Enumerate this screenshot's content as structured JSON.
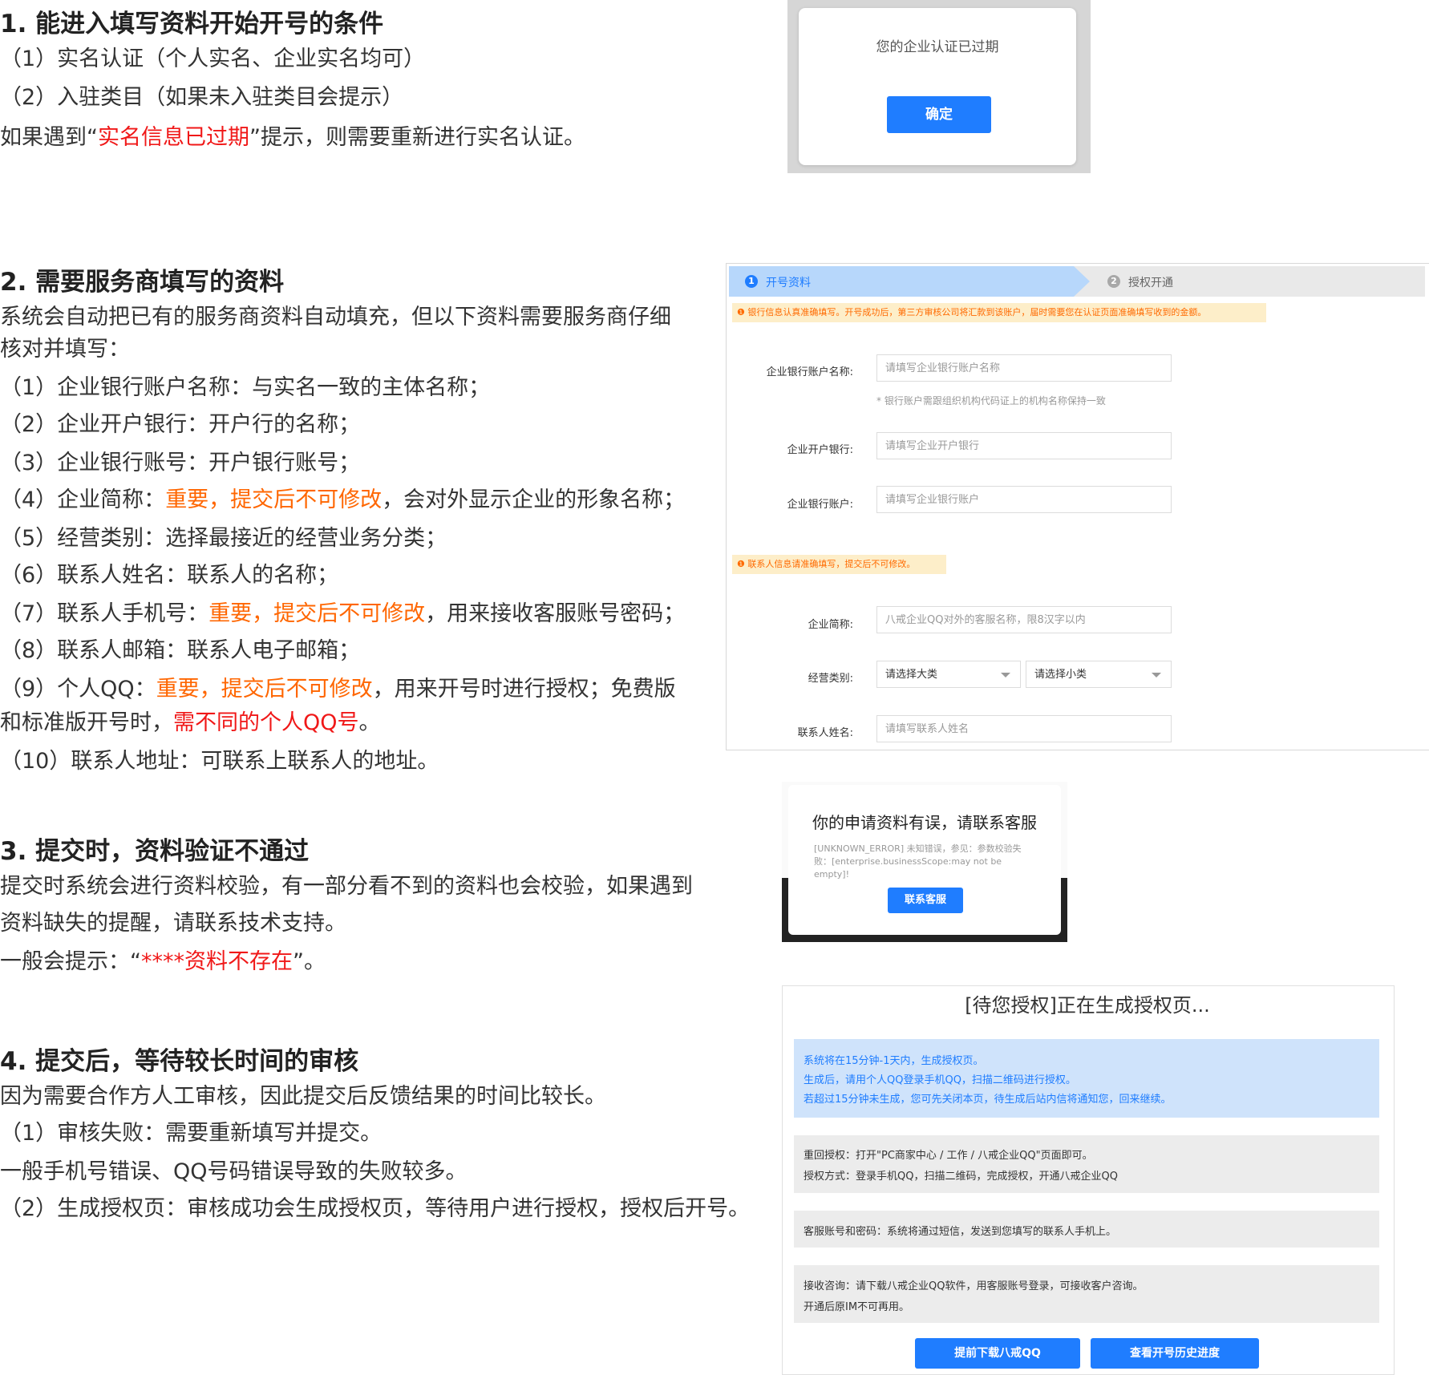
{
  "sec1": {
    "title": "1. 能进入填写资料开始开号的条件",
    "items": [
      "（1）实名认证（个人实名、企业实名均可）",
      "（2）入驻类目（如果未入驻类目会提示）"
    ],
    "note_a": "如果遇到“",
    "note_red": "实名信息已过期",
    "note_b": "”提示，则需要重新进行实名认证。"
  },
  "modal1": {
    "text": "您的企业认证已过期",
    "button": "确定"
  },
  "sec2": {
    "title": "2. 需要服务商填写的资料",
    "intro1": "系统会自动把已有的服务商资料自动填充，但以下资料需要服务商仔细",
    "intro2": "核对并填写：",
    "i1": "（1）企业银行账户名称：与实名一致的主体名称；",
    "i2": "（2）企业开户银行：开户行的名称；",
    "i3": "（3）企业银行账号：开户银行账号；",
    "i4a": "（4）企业简称：",
    "i4o": "重要，提交后不可修改",
    "i4b": "，会对外显示企业的形象名称；",
    "i5": "（5）经营类别：选择最接近的经营业务分类；",
    "i6": "（6）联系人姓名：联系人的名称；",
    "i7a": "（7）联系人手机号：",
    "i7o": "重要，提交后不可修改",
    "i7b": "，用来接收客服账号密码；",
    "i8": "（8）联系人邮箱：联系人电子邮箱；",
    "i9a": "（9）个人QQ：",
    "i9o": "重要，提交后不可修改",
    "i9b": "，用来开号时进行授权；免费版",
    "i9c": "和标准版开号时，",
    "i9r": "需不同的个人QQ号",
    "i9d": "。",
    "i10": "（10）联系人地址：可联系上联系人的地址。"
  },
  "form": {
    "step1_num": "1",
    "step1": "开号资料",
    "step2_num": "2",
    "step2": "授权开通",
    "warn1": "❶ 银行信息认真准确填写。开号成功后，第三方审核公司将汇款到该账户，届时需要您在认证页面准确填写收到的金额。",
    "bank_name_label": "企业银行账户名称:",
    "bank_name_ph": "请填写企业银行账户名称",
    "bank_hint": "* 银行账户需跟组织机构代码证上的机构名称保持一致",
    "bank_label": "企业开户银行:",
    "bank_ph": "请填写企业开户银行",
    "account_label": "企业银行账户:",
    "account_ph": "请填写企业银行账户",
    "warn2": "❶ 联系人信息请准确填写，提交后不可修改。",
    "short_label": "企业简称:",
    "short_ph": "八戒企业QQ对外的客服名称，限8汉字以内",
    "cat_label": "经营类别:",
    "cat_big": "请选择大类",
    "cat_small": "请选择小类",
    "contact_label": "联系人姓名:",
    "contact_ph": "请填写联系人姓名"
  },
  "sec3": {
    "title": "3. 提交时，资料验证不通过",
    "p1": "提交时系统会进行资料校验，有一部分看不到的资料也会校验，如果遇到",
    "p2": "资料缺失的提醒，请联系技术支持。",
    "p3a": "一般会提示：“",
    "p3r": "****资料不存在",
    "p3b": "”。"
  },
  "modal3": {
    "title": "你的申请资料有误，请联系客服",
    "desc": "[UNKNOWN_ERROR] 未知错误，参见：参数校验失败：[enterprise.businessScope:may not be empty]!",
    "button": "联系客服"
  },
  "sec4": {
    "title": "4. 提交后，等待较长时间的审核",
    "p1": "因为需要合作方人工审核，因此提交后反馈结果的时间比较长。",
    "p2": "（1）审核失败：需要重新填写并提交。",
    "p3": "一般手机号错误、QQ号码错误导致的失败较多。",
    "p4": "（2）生成授权页：审核成功会生成授权页，等待用户进行授权，授权后开号。"
  },
  "auth": {
    "title": "[待您授权]正在生成授权页...",
    "blue": [
      "系统将在15分钟-1天内，生成授权页。",
      "生成后，请用个人QQ登录手机QQ，扫描二维码进行授权。",
      "若超过15分钟未生成，您可先关闭本页，待生成后站内信将通知您，回来继续。"
    ],
    "g1": [
      "重回授权：打开\"PC商家中心 / 工作 / 八戒企业QQ\"页面即可。",
      "授权方式：登录手机QQ，扫描二维码，完成授权，开通八戒企业QQ"
    ],
    "g2": "客服账号和密码：系统将通过短信，发送到您填写的联系人手机上。",
    "g3": [
      "接收咨询：请下载八戒企业QQ软件，用客服账号登录，可接收客户咨询。",
      "开通后原IM不可再用。"
    ],
    "btn1": "提前下载八戒QQ",
    "btn2": "查看开号历史进度"
  },
  "colors": {
    "red": "#f01818",
    "orange": "#ff6600",
    "blue_button": "#1f7dff"
  }
}
